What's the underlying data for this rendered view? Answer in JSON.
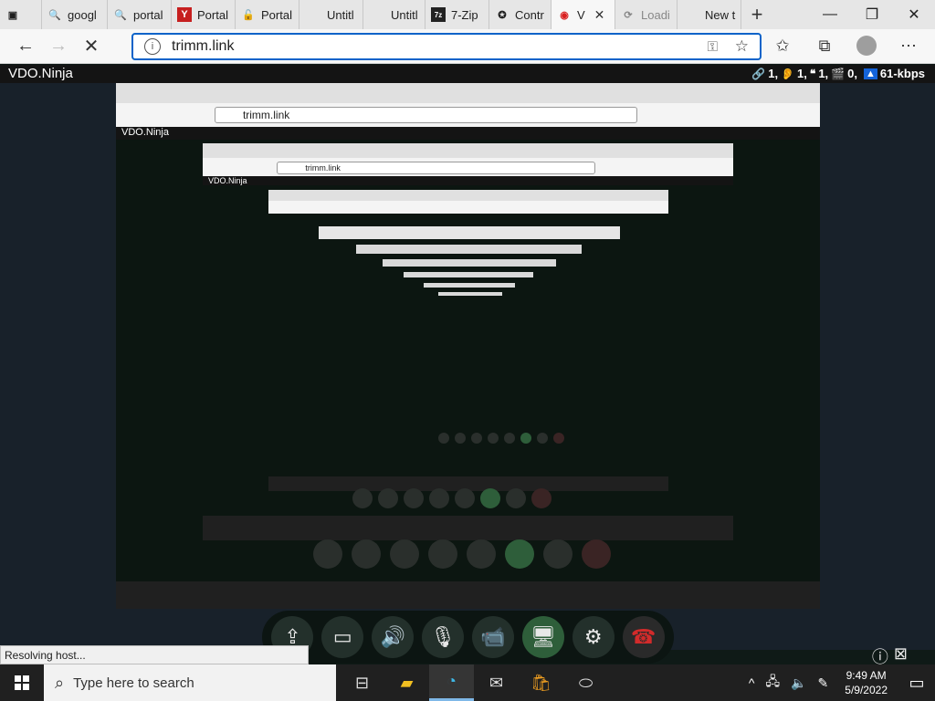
{
  "browser": {
    "tabs": [
      {
        "label": "",
        "icon": "page-icon",
        "active": false
      },
      {
        "label": "googl",
        "icon": "search-icon",
        "active": false
      },
      {
        "label": "portal",
        "icon": "search-icon",
        "active": false
      },
      {
        "label": "Portal",
        "icon": "yandex-icon",
        "active": false
      },
      {
        "label": "Portal",
        "icon": "lock-icon",
        "active": false
      },
      {
        "label": "Untitl",
        "icon": "none",
        "active": false
      },
      {
        "label": "Untitl",
        "icon": "none",
        "active": false
      },
      {
        "label": "7-Zip",
        "icon": "7zip-icon",
        "active": false
      },
      {
        "label": "Contr",
        "icon": "control-icon",
        "active": false
      },
      {
        "label": "V",
        "icon": "vdo-icon",
        "active": true
      },
      {
        "label": "Loadi",
        "icon": "loading-icon",
        "active": false
      },
      {
        "label": "New t",
        "icon": "none",
        "active": false
      }
    ],
    "new_tab": "+",
    "url": "trimm.link"
  },
  "header": {
    "brand": "VDO.Ninja",
    "stats": {
      "links": "1,",
      "ear": "1,",
      "quote": "1,",
      "clapper": "0,",
      "bitrate": "61-kbps"
    }
  },
  "capture": {
    "url": "trimm.link",
    "brand": "VDO.Ninja"
  },
  "status": "Resolving host...",
  "taskbar": {
    "search_placeholder": "Type here to search",
    "time": "9:49 AM",
    "date": "5/9/2022"
  },
  "colors": {
    "accent": "#0b63c9",
    "header_bg": "#141414",
    "page_bg": "#18212a",
    "green_button": "#2e5e3a",
    "hangup_red": "#d22b2b",
    "bitrate_blue": "#1463d9"
  }
}
